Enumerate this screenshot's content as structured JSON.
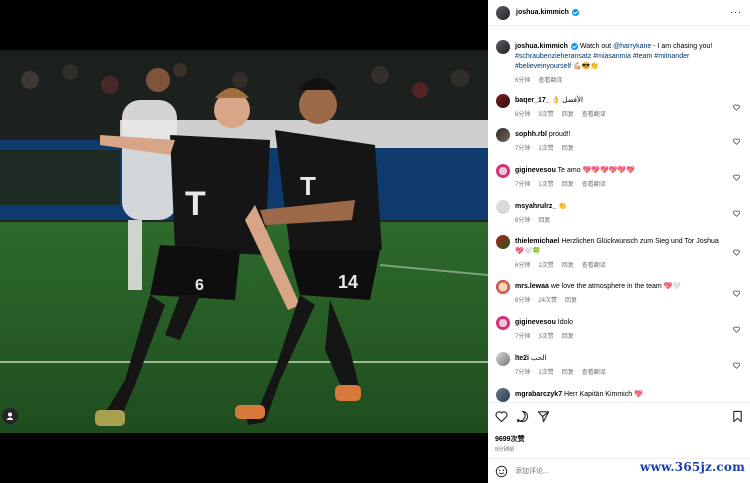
{
  "post": {
    "author": "joshua.kimmich",
    "image_alt": "Two Bayern Munich players in black kits celebrating on the pitch"
  },
  "caption": {
    "author": "joshua.kimmich",
    "text": "Watch out ",
    "mention": "@harrykane",
    "text2": " - I am chasing you!",
    "hashtags": "#schraubenzieheransatz #miasanmia #team #mitnander #believeinyourself",
    "emojis": "💪🏼😎👏",
    "time": "6分钟",
    "translate": "查看翻译"
  },
  "comments": [
    {
      "user": "baqer_17_",
      "text": "👌 الأفضل",
      "time": "6分钟",
      "likes": "3次赞",
      "reply": "回复",
      "translate": "查看翻译"
    },
    {
      "user": "sophh.rbl",
      "text": "proud!!",
      "time": "7分钟",
      "likes": "1次赞",
      "reply": "回复",
      "translate": ""
    },
    {
      "user": "giginevesou",
      "text": "Te amo 💖💖💖💖💖💖",
      "time": "7分钟",
      "likes": "1次赞",
      "reply": "回复",
      "translate": "查看翻译"
    },
    {
      "user": "msyahrulrz_",
      "text": "👏",
      "time": "6分钟",
      "likes": "",
      "reply": "回复",
      "translate": ""
    },
    {
      "user": "thielemichael",
      "text": "Herzlichen Glückwunsch zum Sieg und Tor Joshua 💖🤍🍀",
      "time": "6分钟",
      "likes": "1次赞",
      "reply": "回复",
      "translate": "查看翻译"
    },
    {
      "user": "mrs.lewaa",
      "text": "we love the atmosphere in the team 💖🤍",
      "time": "6分钟",
      "likes": "24次赞",
      "reply": "回复",
      "translate": ""
    },
    {
      "user": "giginevesou",
      "text": "Idolo",
      "time": "7分钟",
      "likes": "3次赞",
      "reply": "回复",
      "translate": ""
    },
    {
      "user": "lte2i",
      "text": "الحب",
      "time": "7分钟",
      "likes": "1次赞",
      "reply": "回复",
      "translate": "查看翻译"
    },
    {
      "user": "mgrabarczyk7",
      "text": "Herr Kapitän Kimmich 💖",
      "time": "",
      "likes": "",
      "reply": "",
      "translate": ""
    }
  ],
  "stats": {
    "likes": "9699次赞",
    "posted": "8分钟前"
  },
  "compose": {
    "placeholder": "添加评论..."
  },
  "watermark": "www.365jz.com",
  "icons": [
    "heart-icon",
    "comment-icon",
    "share-icon",
    "bookmark-icon",
    "emoji-icon",
    "more-icon",
    "verified-icon",
    "user-tag-icon"
  ],
  "colors": {
    "link": "#00376b",
    "meta": "#737373",
    "verified": "#0095f6",
    "watermark": "#1a3ea8"
  }
}
